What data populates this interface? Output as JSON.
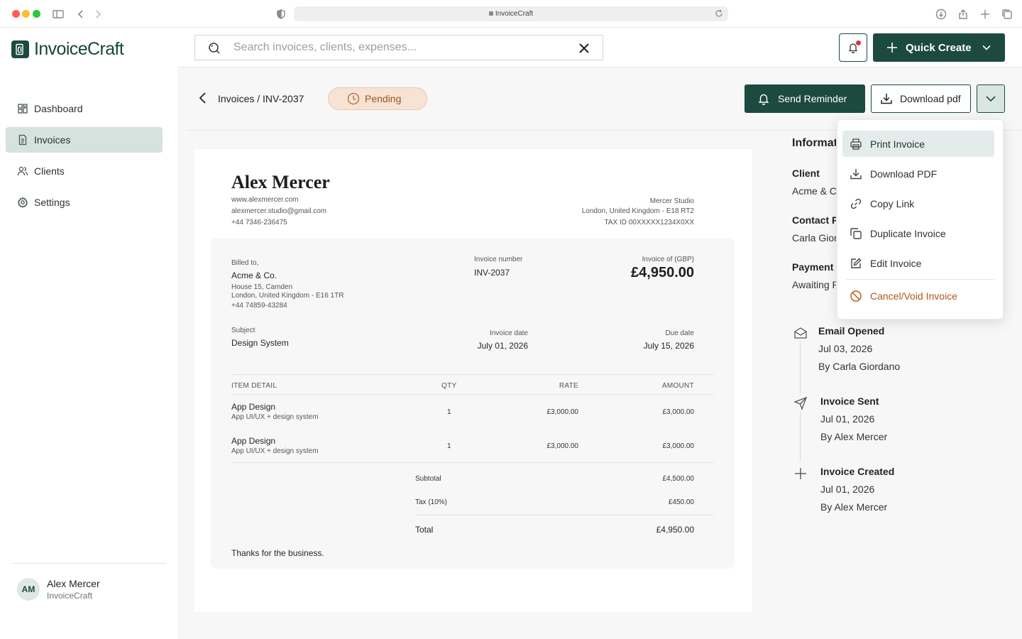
{
  "browser": {
    "url": "InvoiceCraft"
  },
  "app": {
    "name": "InvoiceCraft"
  },
  "sidebar": {
    "items": [
      {
        "label": "Dashboard",
        "icon": "grid-icon",
        "active": false
      },
      {
        "label": "Invoices",
        "icon": "document-icon",
        "active": true
      },
      {
        "label": "Clients",
        "icon": "users-icon",
        "active": false
      },
      {
        "label": "Settings",
        "icon": "gear-icon",
        "active": false
      }
    ],
    "user": {
      "initials": "AM",
      "name": "Alex Mercer",
      "org": "InvoiceCraft"
    }
  },
  "topbar": {
    "search_placeholder": "Search invoices, clients, expenses...",
    "quick_create_label": "Quick Create"
  },
  "header": {
    "breadcrumb": "Invoices / INV-2037",
    "status": "Pending",
    "send_reminder_label": "Send Reminder",
    "download_label": "Download pdf"
  },
  "invoice": {
    "sender_name": "Alex Mercer",
    "sender_website": "www.alexmercer.com",
    "sender_email": "alexmercer.studio@gmail.com",
    "sender_phone": "+44 7346-236475",
    "studio_name": "Mercer Studio",
    "studio_address": "London, United Kingdom - E18 RT2",
    "tax_id": "TAX ID 00XXXXX1234X0XX",
    "billed_to_label": "Billed to,",
    "client_name": "Acme & Co.",
    "client_address_1": "House 15, Camden",
    "client_address_2": "London, United Kingdom - E16 1TR",
    "client_phone": "+44 74859-43284",
    "number_label": "Invoice number",
    "number": "INV-2037",
    "amount_label": "Invoice of (GBP)",
    "amount": "£4,950.00",
    "subject_label": "Subject",
    "subject": "Design System",
    "date_label": "Invoice date",
    "date": "July 01, 2026",
    "due_label": "Due date",
    "due": "July 15, 2026",
    "columns": [
      "ITEM DETAIL",
      "QTY",
      "RATE",
      "AMOUNT"
    ],
    "items": [
      {
        "title": "App Design",
        "desc": "App UI/UX + design system",
        "qty": "1",
        "rate": "£3,000.00",
        "amount": "£3,000.00"
      },
      {
        "title": "App Design",
        "desc": "App UI/UX + design system",
        "qty": "1",
        "rate": "£3,000.00",
        "amount": "£3,000.00"
      }
    ],
    "subtotal_label": "Subtotal",
    "subtotal": "£4,500.00",
    "tax_label": "Tax (10%)",
    "tax": "£450.00",
    "total_label": "Total",
    "total": "£4,950.00",
    "thanks": "Thanks for the business."
  },
  "info": {
    "title": "Information",
    "client_label": "Client",
    "client_value": "Acme & Co.",
    "contact_label": "Contact Person",
    "contact_value": "Carla Giordano",
    "payment_label": "Payment",
    "payment_value": "Awaiting Payment",
    "timeline": [
      {
        "icon": "envelope-open-icon",
        "title": "Email Opened",
        "date": "Jul 03, 2026",
        "by": "By Carla Giordano"
      },
      {
        "icon": "send-icon",
        "title": "Invoice Sent",
        "date": "Jul 01, 2026",
        "by": "By Alex Mercer"
      },
      {
        "icon": "plus-icon",
        "title": "Invoice Created",
        "date": "Jul 01, 2026",
        "by": "By Alex Mercer"
      }
    ]
  },
  "menu": {
    "items": [
      {
        "label": "Print Invoice",
        "icon": "printer-icon"
      },
      {
        "label": "Download PDF",
        "icon": "download-icon"
      },
      {
        "label": "Copy Link",
        "icon": "link-icon"
      },
      {
        "label": "Duplicate Invoice",
        "icon": "duplicate-icon"
      },
      {
        "label": "Edit Invoice",
        "icon": "edit-icon"
      },
      {
        "label": "Cancel/Void Invoice",
        "icon": "ban-icon"
      }
    ]
  },
  "colors": {
    "brand": "#1c4a3f",
    "pending_bg": "#f6e3d4",
    "pending_text": "#a0531d",
    "danger": "#b4561a"
  }
}
